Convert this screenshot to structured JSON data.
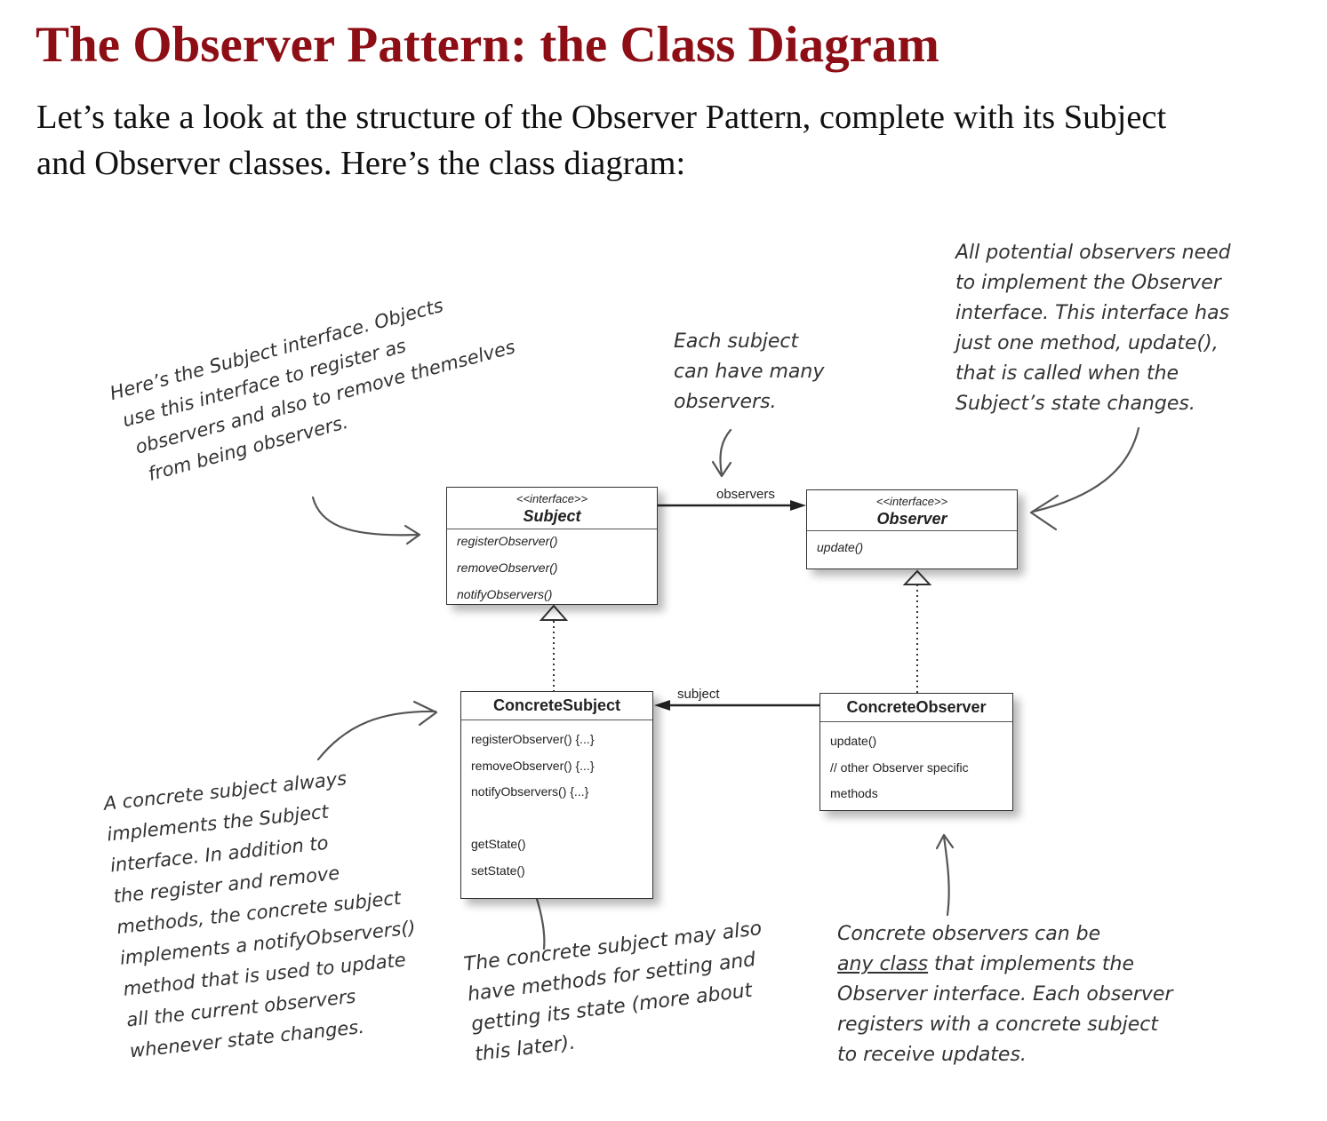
{
  "page": {
    "title": "The Observer Pattern: the Class Diagram",
    "intro_line1": "Let’s take a look at the structure of the Observer Pattern, complete with its Subject",
    "intro_line2": "and Observer classes. Here’s the class diagram:"
  },
  "diagram": {
    "subject": {
      "stereotype": "<<interface>>",
      "name": "Subject",
      "methods": [
        "registerObserver()",
        "removeObserver()",
        "notifyObservers()"
      ]
    },
    "observer": {
      "stereotype": "<<interface>>",
      "name": "Observer",
      "methods": [
        "update()"
      ]
    },
    "concrete_subject": {
      "name": "ConcreteSubject",
      "methods": [
        "registerObserver() {...}",
        "removeObserver() {...}",
        "notifyObservers() {...}",
        "",
        "getState()",
        "setState()"
      ]
    },
    "concrete_observer": {
      "name": "ConcreteObserver",
      "methods": [
        "update()",
        "// other Observer specific",
        "methods"
      ]
    },
    "edges": {
      "observers_label": "observers",
      "subject_label": "subject"
    }
  },
  "annotations": {
    "subject_interface": [
      "Here’s the Subject interface. Objects",
      "use this interface to register as",
      "observers and also to remove themselves",
      "from being observers."
    ],
    "each_subject": [
      "Each subject",
      "can have many",
      "observers."
    ],
    "observer_interface": [
      "All potential observers need",
      "to implement the Observer",
      "interface. This interface has",
      "just one method, update(),",
      "that is called when the",
      "Subject’s state changes."
    ],
    "concrete_subject": [
      "A concrete subject always",
      "implements the Subject",
      "interface. In addition to",
      "the register and remove",
      "methods, the concrete subject",
      "implements a notifyObservers()",
      "method that is used to update",
      "all the current observers",
      "whenever state changes."
    ],
    "state_methods": [
      "The concrete subject may also",
      "have methods for setting and",
      "getting its state (more about",
      "this later)."
    ],
    "concrete_observers": {
      "line1": "Concrete observers can be",
      "line2_underlined": "any class",
      "line2_rest": " that implements the",
      "line3": "Observer interface. Each observer",
      "line4": "registers with a concrete subject",
      "line5": "to receive updates."
    }
  }
}
